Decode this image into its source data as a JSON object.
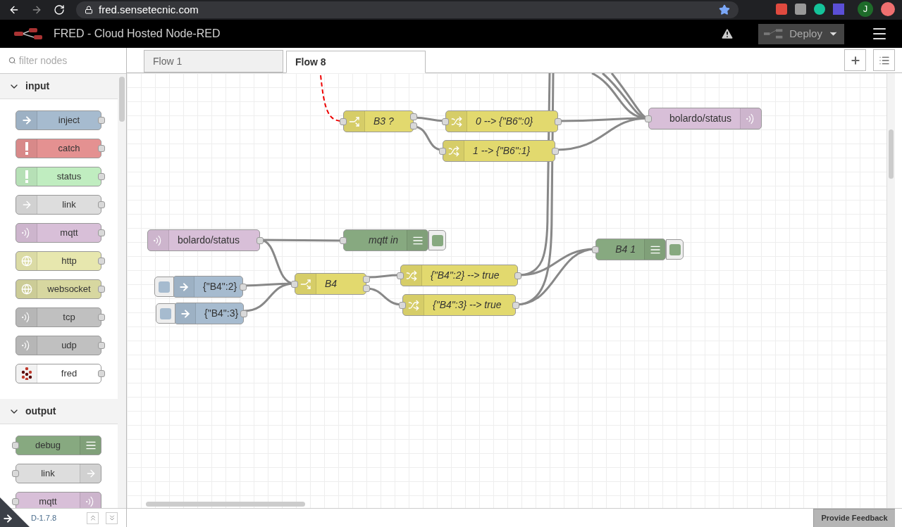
{
  "browser": {
    "url": "fred.sensetecnic.com",
    "avatar": "J"
  },
  "header": {
    "title": "FRED - Cloud Hosted Node-RED",
    "deploy": "Deploy"
  },
  "palette": {
    "filter_placeholder": "filter nodes",
    "categories": [
      {
        "name": "input",
        "kind": "input",
        "expanded": true,
        "nodes": [
          {
            "label": "inject",
            "kind": "inject"
          },
          {
            "label": "catch",
            "kind": "catch"
          },
          {
            "label": "status",
            "kind": "status"
          },
          {
            "label": "link",
            "kind": "link"
          },
          {
            "label": "mqtt",
            "kind": "mqtt"
          },
          {
            "label": "http",
            "kind": "http"
          },
          {
            "label": "websocket",
            "kind": "websocket"
          },
          {
            "label": "tcp",
            "kind": "tcp"
          },
          {
            "label": "udp",
            "kind": "udp"
          },
          {
            "label": "fred",
            "kind": "fred"
          }
        ]
      },
      {
        "name": "output",
        "kind": "output",
        "expanded": true,
        "nodes": [
          {
            "label": "debug",
            "kind": "debug"
          },
          {
            "label": "link",
            "kind": "link"
          },
          {
            "label": "mqtt",
            "kind": "mqtt"
          }
        ]
      }
    ]
  },
  "tabs": [
    {
      "label": "Flow 1",
      "selected": false
    },
    {
      "label": "Flow 8",
      "selected": true
    }
  ],
  "canvas": {
    "nodes": [
      {
        "kind": "switch",
        "label": "B3 ?"
      },
      {
        "kind": "change",
        "label": "0 --> {\"B6\":0}"
      },
      {
        "kind": "change",
        "label": "1 --> {\"B6\":1}"
      },
      {
        "kind": "mqtt-out",
        "label": "bolardo/status"
      },
      {
        "kind": "mqtt-in",
        "label": "bolardo/status"
      },
      {
        "kind": "debug",
        "label": "mqtt in"
      },
      {
        "kind": "debug",
        "label": "B4 1"
      },
      {
        "kind": "inject",
        "label": "{\"B4\":2}"
      },
      {
        "kind": "inject",
        "label": "{\"B4\":3}"
      },
      {
        "kind": "switch",
        "label": "B4"
      },
      {
        "kind": "change",
        "label": "{\"B4\":2} --> true"
      },
      {
        "kind": "change",
        "label": "{\"B4\":3} --> true"
      }
    ]
  },
  "footer": {
    "version": "D-1.7.8",
    "feedback": "Provide Feedback"
  }
}
